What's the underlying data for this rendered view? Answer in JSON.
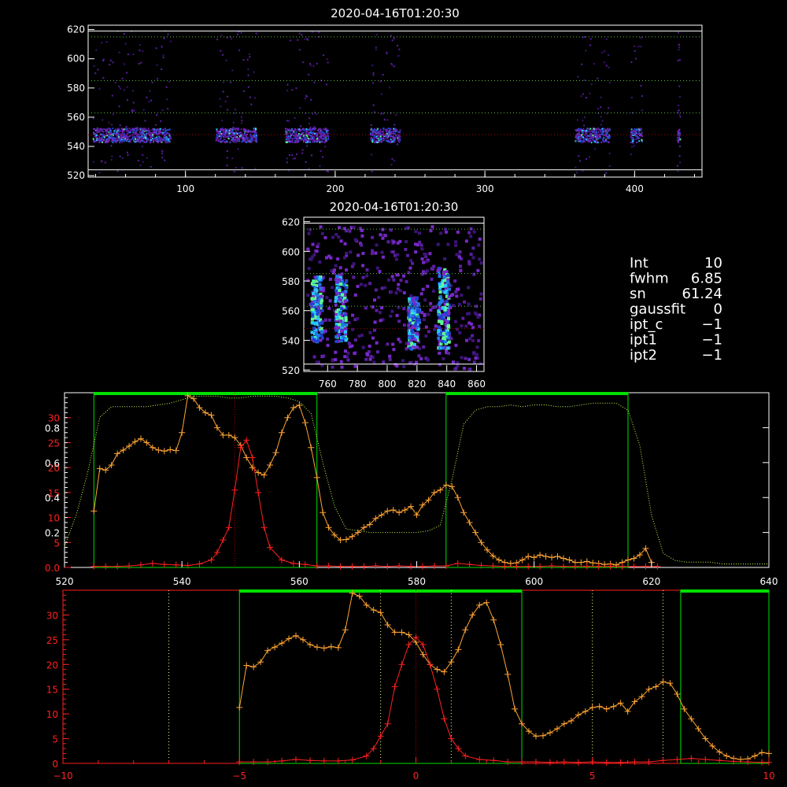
{
  "panel1": {
    "title": "2020-04-16T01:20:30",
    "xticks": [
      "100",
      "200",
      "300",
      "400"
    ],
    "xtick_values": [
      100,
      200,
      300,
      400
    ],
    "xlim": [
      35,
      445
    ],
    "yticks": [
      "520",
      "540",
      "560",
      "580",
      "600",
      "620"
    ],
    "ylim": [
      519,
      623
    ],
    "hlines": [
      524,
      548,
      563,
      585,
      615,
      619
    ],
    "blobs": [
      [
        38,
        90,
        548
      ],
      [
        120,
        147,
        548
      ],
      [
        166,
        195,
        548
      ],
      [
        223,
        243,
        548
      ],
      [
        360,
        383,
        548
      ],
      [
        397,
        405,
        548
      ],
      [
        428,
        430,
        548
      ]
    ]
  },
  "panel2": {
    "title": "2020-04-16T01:20:30",
    "xticks": [
      "760",
      "780",
      "800",
      "820",
      "840",
      "860"
    ],
    "xtick_values": [
      760,
      780,
      800,
      820,
      840,
      860
    ],
    "xlim": [
      744,
      865
    ],
    "yticks": [
      "520",
      "540",
      "560",
      "580",
      "600",
      "620"
    ],
    "ylim": [
      519,
      623
    ],
    "streaks": [
      [
        752,
        540,
        585
      ],
      [
        768,
        540,
        585
      ],
      [
        817,
        535,
        570
      ],
      [
        837,
        535,
        590
      ]
    ]
  },
  "params": [
    {
      "label": "Int",
      "value": "10"
    },
    {
      "label": "fwhm",
      "value": "6.85"
    },
    {
      "label": "sn",
      "value": "61.24"
    },
    {
      "label": "gaussfit",
      "value": "0"
    },
    {
      "label": "ipt_c",
      "value": "−1"
    },
    {
      "label": "ipt1",
      "value": "−1"
    },
    {
      "label": "ipt2",
      "value": "−1"
    }
  ],
  "colors": {
    "orange": "#ffa533",
    "red": "#ff2020",
    "green": "#00e000",
    "lightgreen": "#c8ff50",
    "yellowdot": "#ffff80",
    "darkred": "#b00000"
  },
  "chart_data": [
    {
      "type": "line",
      "title": "",
      "xlim": [
        520,
        640
      ],
      "xticks": [
        "520",
        "540",
        "560",
        "580",
        "600",
        "620",
        "640"
      ],
      "xtick_values": [
        520,
        540,
        560,
        580,
        600,
        620,
        640
      ],
      "ylim_left": [
        0,
        35
      ],
      "yticks_left": [
        "0.0",
        "5",
        "10",
        "15",
        "20",
        "25",
        "30"
      ],
      "ytick_left_values": [
        0,
        5,
        10,
        15,
        20,
        25,
        30
      ],
      "ylim_right": [
        0,
        1.0
      ],
      "yticks_right": [
        "0.2",
        "0.4",
        "0.6",
        "0.8"
      ],
      "ytick_right_values": [
        0.2,
        0.4,
        0.6,
        0.8
      ],
      "green_boxes": [
        [
          525,
          563
        ],
        [
          585,
          616
        ]
      ],
      "vline": 549,
      "series": [
        {
          "color": "orange",
          "x": [
            525,
            526,
            527,
            528,
            529,
            530,
            531,
            532,
            533,
            534,
            535,
            536,
            537,
            538,
            539,
            540,
            541,
            542,
            543,
            544,
            545,
            546,
            547,
            548,
            549,
            550,
            551,
            552,
            553,
            554,
            555,
            556,
            557,
            558,
            559,
            560,
            561,
            562,
            563,
            564,
            565,
            566,
            567,
            568,
            569,
            570,
            571,
            572,
            573,
            574,
            575,
            576,
            577,
            578,
            579,
            580,
            581,
            582,
            583,
            584,
            585,
            586,
            587,
            588,
            589,
            590,
            591,
            592,
            593,
            594,
            595,
            596,
            597,
            598,
            599,
            600,
            601,
            602,
            603,
            604,
            605,
            606,
            607,
            608,
            609,
            610,
            611,
            612,
            613,
            614,
            615,
            616,
            617,
            618,
            619,
            620
          ],
          "y": [
            11.3,
            19.8,
            19.5,
            20.5,
            22.8,
            23.5,
            24.3,
            25.2,
            25.8,
            25.0,
            24.0,
            23.5,
            23.3,
            23.6,
            23.4,
            27.0,
            34.4,
            33.8,
            32.0,
            31.0,
            30.5,
            28.0,
            26.5,
            26.5,
            26.0,
            24.5,
            22.0,
            20.0,
            19.0,
            18.5,
            20.5,
            23.0,
            27.0,
            30.0,
            32.0,
            32.5,
            29.0,
            24.0,
            18.0,
            11.0,
            8.0,
            6.5,
            5.5,
            5.6,
            6.2,
            7.0,
            8.0,
            8.6,
            9.8,
            10.5,
            11.3,
            11.5,
            11.0,
            11.5,
            12.2,
            10.5,
            12.5,
            13.5,
            15.0,
            15.5,
            16.5,
            16.2,
            14.0,
            11.0,
            9.0,
            7.0,
            5.0,
            3.5,
            2.3,
            1.5,
            1.0,
            0.8,
            0.9,
            1.5,
            2.2,
            2.0,
            2.5,
            2.2,
            2.0,
            2.2,
            1.8,
            1.5,
            1.0,
            1.0,
            1.2,
            0.9,
            0.8,
            0.6,
            0.7,
            0.5,
            1.0,
            1.5,
            1.8,
            2.5,
            3.8,
            1.0
          ]
        },
        {
          "color": "red",
          "x": [
            525,
            527,
            529,
            531,
            533,
            535,
            537,
            539,
            541,
            543,
            545,
            546,
            547,
            548,
            549,
            550,
            551,
            552,
            553,
            554,
            555,
            557,
            559,
            561,
            563,
            565,
            567,
            569,
            571,
            573,
            575,
            577,
            579,
            581,
            583,
            585,
            587,
            589,
            591,
            593,
            595,
            597,
            599,
            601,
            603,
            605,
            607,
            609,
            611,
            613,
            615,
            617,
            619,
            621
          ],
          "y": [
            0.2,
            0.2,
            0.2,
            0.3,
            0.5,
            0.8,
            0.6,
            0.5,
            0.4,
            0.7,
            1.5,
            3.0,
            5.5,
            8.0,
            15.5,
            24.0,
            25.5,
            22.0,
            15.0,
            8.0,
            4.0,
            1.5,
            0.8,
            0.6,
            0.3,
            0.3,
            0.2,
            0.2,
            0.2,
            0.3,
            0.2,
            0.3,
            0.2,
            0.2,
            0.3,
            0.3,
            0.8,
            0.6,
            0.4,
            0.3,
            0.2,
            0.2,
            0.2,
            0.2,
            0.3,
            0.2,
            0.2,
            0.2,
            0.2,
            0.2,
            0.2,
            0.2,
            0.2,
            0.2
          ]
        },
        {
          "color": "lightgreen",
          "axis": "right",
          "x": [
            520,
            522,
            524,
            526,
            528,
            530,
            532,
            534,
            536,
            538,
            540,
            542,
            544,
            546,
            548,
            550,
            552,
            554,
            556,
            558,
            560,
            562,
            564,
            566,
            568,
            570,
            572,
            574,
            576,
            578,
            580,
            582,
            584,
            586,
            588,
            590,
            592,
            594,
            596,
            598,
            600,
            602,
            604,
            606,
            608,
            610,
            612,
            614,
            616,
            618,
            620,
            622,
            624,
            626,
            628,
            630,
            632,
            634,
            636,
            638,
            640
          ],
          "y": [
            0.12,
            0.3,
            0.55,
            0.86,
            0.92,
            0.92,
            0.92,
            0.92,
            0.93,
            0.94,
            0.96,
            0.98,
            0.98,
            0.98,
            0.97,
            0.97,
            0.98,
            0.98,
            0.98,
            0.97,
            0.95,
            0.88,
            0.6,
            0.35,
            0.22,
            0.21,
            0.2,
            0.2,
            0.2,
            0.2,
            0.2,
            0.21,
            0.24,
            0.5,
            0.82,
            0.9,
            0.92,
            0.92,
            0.93,
            0.92,
            0.93,
            0.93,
            0.92,
            0.92,
            0.93,
            0.94,
            0.94,
            0.94,
            0.9,
            0.7,
            0.3,
            0.08,
            0.04,
            0.03,
            0.03,
            0.03,
            0.02,
            0.02,
            0.02,
            0.02,
            0.02
          ]
        }
      ]
    },
    {
      "type": "line",
      "title": "",
      "xlim": [
        -10,
        10
      ],
      "xticks": [
        "−10",
        "−5",
        "0",
        "5",
        "10"
      ],
      "xtick_values": [
        -10,
        -5,
        0,
        5,
        10
      ],
      "ylim": [
        0,
        35
      ],
      "yticks": [
        "0",
        "5",
        "10",
        "15",
        "20",
        "25",
        "30"
      ],
      "ytick_values": [
        0,
        5,
        10,
        15,
        20,
        25,
        30
      ],
      "green_boxes": [
        [
          -5,
          3
        ],
        [
          7.5,
          10
        ]
      ],
      "dotted_lines": [
        -7,
        -1,
        1,
        5,
        7
      ],
      "vline": 0,
      "series": [
        {
          "color": "orange",
          "x": [
            -5,
            -4.8,
            -4.6,
            -4.4,
            -4.2,
            -4.0,
            -3.8,
            -3.6,
            -3.4,
            -3.2,
            -3.0,
            -2.8,
            -2.6,
            -2.4,
            -2.2,
            -2.0,
            -1.8,
            -1.6,
            -1.4,
            -1.2,
            -1.0,
            -0.8,
            -0.6,
            -0.4,
            -0.2,
            0,
            0.2,
            0.4,
            0.6,
            0.8,
            1.0,
            1.2,
            1.4,
            1.6,
            1.8,
            2.0,
            2.2,
            2.4,
            2.6,
            2.8,
            3.0,
            3.2,
            3.4,
            3.6,
            3.8,
            4.0,
            4.2,
            4.4,
            4.6,
            4.8,
            5.0,
            5.2,
            5.4,
            5.6,
            5.8,
            6.0,
            6.2,
            6.4,
            6.6,
            6.8,
            7.0,
            7.2,
            7.4,
            7.6,
            7.8,
            8.0,
            8.2,
            8.4,
            8.6,
            8.8,
            9.0,
            9.2,
            9.4,
            9.6,
            9.8,
            10.0
          ],
          "y": [
            11.3,
            19.8,
            19.5,
            20.5,
            22.8,
            23.5,
            24.3,
            25.2,
            25.8,
            25.0,
            24.0,
            23.5,
            23.3,
            23.6,
            23.4,
            27.0,
            34.4,
            33.8,
            32.0,
            31.0,
            30.5,
            28.0,
            26.5,
            26.5,
            26.0,
            24.5,
            22.0,
            20.0,
            19.0,
            18.5,
            20.5,
            23.0,
            27.0,
            30.0,
            32.0,
            32.5,
            29.0,
            24.0,
            18.0,
            11.0,
            8.0,
            6.5,
            5.5,
            5.6,
            6.2,
            7.0,
            8.0,
            8.6,
            9.8,
            10.5,
            11.3,
            11.5,
            11.0,
            11.5,
            12.2,
            10.5,
            12.5,
            13.5,
            15.0,
            15.5,
            16.5,
            16.2,
            14.0,
            11.0,
            9.0,
            7.0,
            5.0,
            3.5,
            2.3,
            1.5,
            1.0,
            0.8,
            0.9,
            1.5,
            2.2,
            2.0
          ]
        },
        {
          "color": "red",
          "x": [
            -5,
            -4.6,
            -4.2,
            -3.8,
            -3.4,
            -3.0,
            -2.6,
            -2.2,
            -1.8,
            -1.4,
            -1.2,
            -1.0,
            -0.8,
            -0.6,
            -0.4,
            -0.2,
            0,
            0.2,
            0.4,
            0.6,
            0.8,
            1.0,
            1.2,
            1.4,
            1.8,
            2.2,
            2.6,
            3.0,
            3.4,
            3.8,
            4.2,
            4.6,
            5.0,
            5.4,
            5.8,
            6.2,
            6.6,
            7.0,
            7.4,
            7.8,
            8.2,
            8.6,
            9.0,
            9.4,
            9.8,
            10.0
          ],
          "y": [
            0.3,
            0.3,
            0.3,
            0.5,
            0.8,
            0.6,
            0.5,
            0.5,
            0.7,
            1.5,
            3.0,
            5.5,
            8.0,
            15.5,
            20.0,
            24.0,
            25.5,
            24.0,
            20.0,
            15.0,
            9.0,
            5.0,
            3.0,
            1.5,
            0.8,
            0.6,
            0.3,
            0.3,
            0.3,
            0.2,
            0.3,
            0.2,
            0.3,
            0.2,
            0.2,
            0.3,
            0.3,
            0.6,
            0.8,
            1.0,
            0.8,
            0.6,
            0.4,
            0.3,
            0.2,
            0.2
          ]
        }
      ]
    }
  ]
}
